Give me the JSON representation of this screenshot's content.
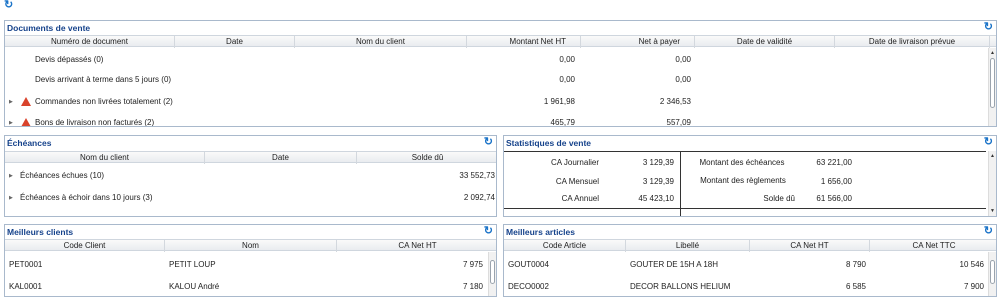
{
  "top_refresh": "↻",
  "documents": {
    "title": "Documents de vente",
    "refresh": "↻",
    "columns": [
      "Numéro de document",
      "Date",
      "Nom du client",
      "Montant Net HT",
      "Net à payer",
      "Date de validité",
      "Date de livraison prévue"
    ],
    "rows": [
      {
        "label": "Devis dépassés (0)",
        "montant": "0,00",
        "net": "0,00",
        "expand": false,
        "warn": false
      },
      {
        "label": "Devis arrivant à terme dans 5 jours (0)",
        "montant": "0,00",
        "net": "0,00",
        "expand": false,
        "warn": false
      },
      {
        "label": "Commandes non livrées totalement (2)",
        "montant": "1 961,98",
        "net": "2 346,53",
        "expand": true,
        "warn": true
      },
      {
        "label": "Bons de livraison non facturés (2)",
        "montant": "465,79",
        "net": "557,09",
        "expand": true,
        "warn": true
      }
    ]
  },
  "echeances": {
    "title": "Échéances",
    "refresh": "↻",
    "columns": [
      "Nom du client",
      "Date",
      "Solde dû"
    ],
    "rows": [
      {
        "label": "Échéances échues (10)",
        "solde": "33 552,73"
      },
      {
        "label": "Échéances à échoir dans 10 jours (3)",
        "solde": "2 092,74"
      }
    ]
  },
  "stats": {
    "title": "Statistiques de vente",
    "refresh": "↻",
    "left": [
      {
        "label": "CA Journalier",
        "value": "3 129,39"
      },
      {
        "label": "CA Mensuel",
        "value": "3 129,39"
      },
      {
        "label": "CA Annuel",
        "value": "45 423,10"
      }
    ],
    "right": [
      {
        "label": "Montant des échéances",
        "value": "63 221,00"
      },
      {
        "label": "Montant des règlements",
        "value": "1 656,00"
      },
      {
        "label": "Solde dû",
        "value": "61 566,00"
      }
    ]
  },
  "clients": {
    "title": "Meilleurs clients",
    "refresh": "↻",
    "columns": [
      "Code Client",
      "Nom",
      "CA Net HT"
    ],
    "rows": [
      {
        "code": "PET0001",
        "nom": "PETIT LOUP",
        "ca": "7 975"
      },
      {
        "code": "KAL0001",
        "nom": "KALOU André",
        "ca": "7 180"
      }
    ]
  },
  "articles": {
    "title": "Meilleurs articles",
    "refresh": "↻",
    "columns": [
      "Code Article",
      "Libellé",
      "CA Net HT",
      "CA Net TTC"
    ],
    "rows": [
      {
        "code": "GOUT0004",
        "libelle": "GOUTER DE 15H A 18H",
        "ht": "8 790",
        "ttc": "10 546"
      },
      {
        "code": "DECO0002",
        "libelle": "DECOR BALLONS HELIUM",
        "ht": "6 585",
        "ttc": "7 900"
      }
    ]
  }
}
